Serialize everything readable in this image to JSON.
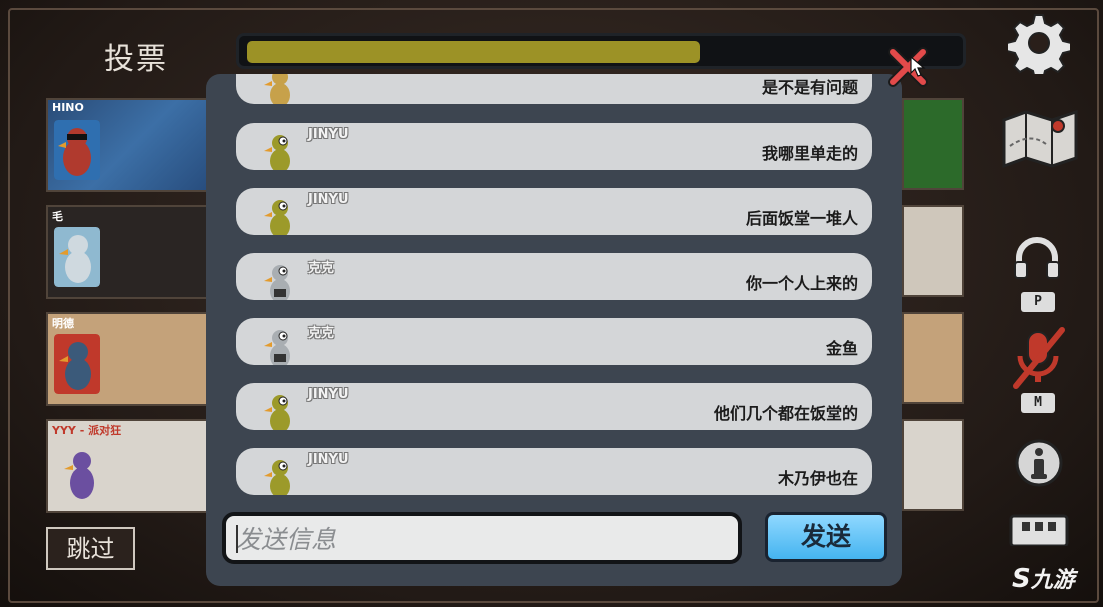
{
  "header": {
    "title": "投票",
    "timer_progress": 0.64
  },
  "players": [
    {
      "name": "HINO",
      "color": "#b03a2e"
    },
    {
      "name": "毛",
      "color": "#9fb8c8"
    },
    {
      "name": "明德",
      "color": "#b03a2e"
    },
    {
      "name": "YYY - 派对狂",
      "color": "#6b4fa0"
    }
  ],
  "skip_label": "跳过",
  "hotkeys": {
    "voice": "P",
    "mic": "M"
  },
  "chat": {
    "messages": [
      {
        "sender": "",
        "text": "是不是有问题",
        "avatar_color": "#c7a14a"
      },
      {
        "sender": "JINYU",
        "text": "我哪里单走的",
        "avatar_color": "#9c9a2a"
      },
      {
        "sender": "JINYU",
        "text": "后面饭堂一堆人",
        "avatar_color": "#9c9a2a"
      },
      {
        "sender": "克克",
        "text": "你一个人上来的",
        "avatar_color": "#a9aeb2"
      },
      {
        "sender": "克克",
        "text": "金鱼",
        "avatar_color": "#a9aeb2"
      },
      {
        "sender": "JINYU",
        "text": "他们几个都在饭堂的",
        "avatar_color": "#9c9a2a"
      },
      {
        "sender": "JINYU",
        "text": "木乃伊也在",
        "avatar_color": "#9c9a2a"
      }
    ],
    "input_placeholder": "发送信息",
    "send_label": "发送"
  },
  "watermark": "九游"
}
